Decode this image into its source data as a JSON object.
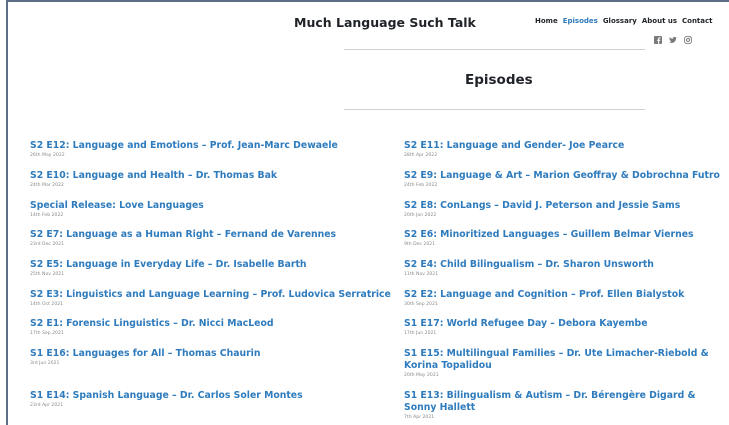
{
  "site": {
    "title": "Much Language Such Talk"
  },
  "nav": {
    "items": [
      "Home",
      "Episodes",
      "Glossary",
      "About us",
      "Contact"
    ],
    "active": "Episodes",
    "accent": "#2e7bbd"
  },
  "social": {
    "icons": [
      "facebook-icon",
      "twitter-icon",
      "instagram-icon"
    ]
  },
  "page": {
    "title": "Episodes"
  },
  "episodes": {
    "left": [
      {
        "title": "S2 E12: Language and Emotions – Prof. Jean-Marc Dewaele",
        "date": "26th May 2022"
      },
      {
        "title": "S2 E10: Language and Health – Dr. Thomas Bak",
        "date": "24th Mar 2022"
      },
      {
        "title": "Special Release: Love Languages",
        "date": "14th Feb 2022"
      },
      {
        "title": "S2 E7: Language as a Human Right – Fernand de Varennes",
        "date": "23rd Dec 2021"
      },
      {
        "title": "S2 E5: Language in Everyday Life – Dr. Isabelle Barth",
        "date": "25th Nov 2021"
      },
      {
        "title": "S2 E3: Linguistics and Language Learning – Prof. Ludovica Serratrice",
        "date": "14th Oct 2021"
      },
      {
        "title": "S2 E1: Forensic Linguistics – Dr. Nicci MacLeod",
        "date": "17th Sep 2021"
      },
      {
        "title": "S1 E16: Languages for All – Thomas Chaurin",
        "date": "3rd Jun 2021"
      },
      {
        "title": "S1 E14: Spanish Language – Dr. Carlos Soler Montes",
        "date": "23rd Apr 2021"
      }
    ],
    "right": [
      {
        "title": "S2 E11: Language and Gender- Joe Pearce",
        "date": "28th Apr 2022"
      },
      {
        "title": "S2 E9: Language & Art – Marion Geoffray & Dobrochna Futro",
        "date": "24th Feb 2022"
      },
      {
        "title": "S2 E8: ConLangs – David J. Peterson and Jessie Sams",
        "date": "20th Jan 2022"
      },
      {
        "title": "S2 E6: Minoritized Languages – Guillem Belmar Viernes",
        "date": "9th Dec 2021"
      },
      {
        "title": "S2 E4: Child Bilingualism – Dr. Sharon Unsworth",
        "date": "11th Nov 2021"
      },
      {
        "title": "S2 E2: Language and Cognition – Prof. Ellen Bialystok",
        "date": "30th Sep 2021"
      },
      {
        "title": "S1 E17: World Refugee Day – Debora Kayembe",
        "date": "17th Jun 2021"
      },
      {
        "title": "S1 E15: Multilingual Families – Dr. Ute Limacher-Riebold &",
        "title2": "Korina Topalidou",
        "date": "20th May 2021"
      },
      {
        "title": "S1 E13: Bilingualism & Autism – Dr. Bérengère Digard &",
        "title2": "Sonny Hallett",
        "date": "7th Apr 2021"
      }
    ]
  }
}
